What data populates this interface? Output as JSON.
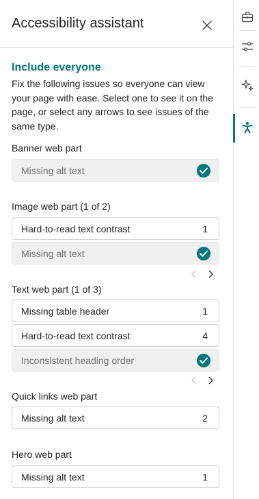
{
  "colors": {
    "accent": "#03787c",
    "text": "#242424",
    "muted": "#707070",
    "resolved_bg": "#f0f0f0",
    "border": "#d1d1d1"
  },
  "header": {
    "title": "Accessibility assistant",
    "close_icon": "close-icon"
  },
  "intro": {
    "title": "Include everyone",
    "text": "Fix the following issues so everyone can view your page with ease. Select one to see it on the page, or select any arrows to see issues of the same type."
  },
  "sections": [
    {
      "title": "Banner web part",
      "items": [
        {
          "label": "Missing alt text",
          "resolved": true
        }
      ]
    },
    {
      "title": "Image web part (1 of 2)",
      "items": [
        {
          "label": "Hard-to-read text contrast",
          "count": "1",
          "resolved": false
        },
        {
          "label": "Missing alt text",
          "resolved": true
        }
      ],
      "pager": true
    },
    {
      "title": "Text web part (1 of 3)",
      "items": [
        {
          "label": "Missing table header",
          "count": "1",
          "resolved": false
        },
        {
          "label": "Hard-to-read text contrast",
          "count": "4",
          "resolved": false
        },
        {
          "label": "Inconsistent heading order",
          "resolved": true
        }
      ],
      "pager": true
    },
    {
      "title": "Quick links web part",
      "items": [
        {
          "label": "Missing alt text",
          "count": "2",
          "resolved": false
        }
      ]
    },
    {
      "title": "Hero web part",
      "items": [
        {
          "label": "Missing alt text",
          "count": "1",
          "resolved": false
        }
      ]
    }
  ],
  "rail": {
    "icons": [
      "toolbox-icon",
      "sliders-icon",
      "sparkle-icon",
      "accessibility-icon"
    ],
    "active": "accessibility-icon"
  }
}
